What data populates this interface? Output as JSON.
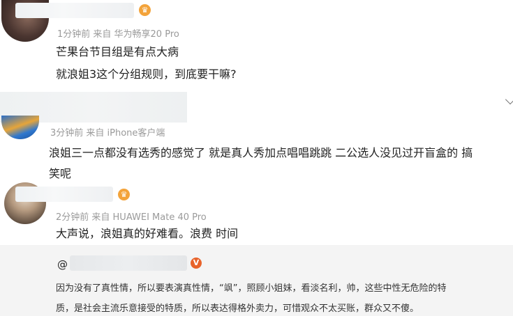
{
  "comments": [
    {
      "meta": "1分钟前  来自 华为畅享20 Pro",
      "lines": [
        "芒果台节目组是有点大病",
        "就浪姐3这个分组规则，到底要干嘛?"
      ]
    },
    {
      "meta": "3分钟前  来自 iPhone客户端",
      "lines": [
        "浪姐三一点都没有选秀的感觉了 就是真人秀加点唱唱跳跳 二公选人没见过开盲盒的 搞",
        "笑呢"
      ]
    },
    {
      "meta": "2分钟前  来自 HUAWEI Mate 40 Pro",
      "lines": [
        "大声说，浪姐真的好难看。浪费    时间"
      ]
    }
  ],
  "reply": {
    "at": "@",
    "lines": [
      "因为没有了真性情，所以要表演真性情，“飒”，照顾小姐妹，看淡名利，帅，这些中性无危险的特",
      "质，是社会主流乐意接受的特质，所以表达得格外卖力，可惜观众不太买账，群众又不傻。"
    ]
  },
  "icons": {
    "badge": "membership-badge-icon",
    "verify": "verified-v-icon",
    "chevron": "chevron-down-icon"
  },
  "colors": {
    "meta": "#9a9a9a",
    "badge": "#f3a33a",
    "verify": "#e8632b",
    "reply_bg": "#f4f4f4"
  }
}
